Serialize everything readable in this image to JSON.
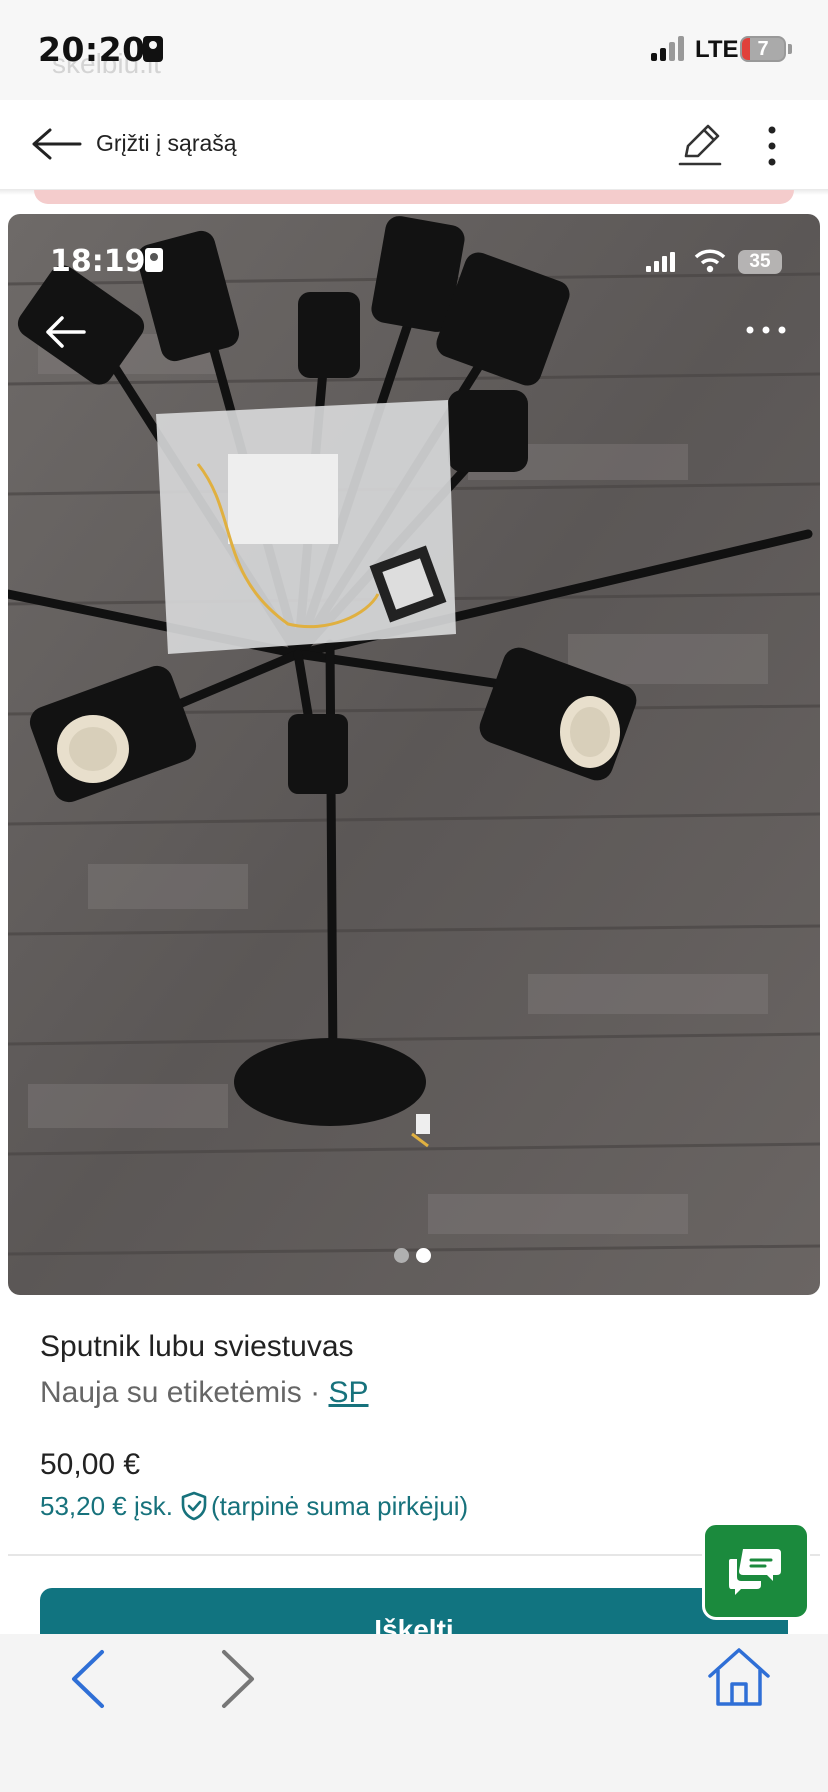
{
  "status_bar": {
    "time": "20:20",
    "network": "LTE",
    "battery_level": "7",
    "battery_color": "#e0403a",
    "background_logo_text": "skelbiu.lt"
  },
  "header": {
    "back_label": "Grįžti į sąrašą",
    "back_icon": "arrow-left-icon",
    "edit_icon": "pencil-icon",
    "more_icon": "more-vertical-icon"
  },
  "photo": {
    "embedded_status_time": "18:19",
    "embedded_battery_level": "35",
    "description_icon_back": "arrow-left-icon",
    "description_icon_more": "more-horizontal-icon",
    "pagination": {
      "count": 2,
      "active_index": 1
    }
  },
  "listing": {
    "title": "Sputnik lubu sviestuvas",
    "condition": "Nauja su etiketėmis",
    "separator": "·",
    "seller_tag": "SP",
    "price": "50,00 €",
    "buyer_price_prefix": "53,20 € įsk.",
    "buyer_price_suffix": "(tarpinė suma pirkėjui)",
    "cta_label": "Iškelti"
  },
  "colors": {
    "accent_teal": "#117480",
    "link_teal": "#17727c",
    "chat_green": "#1b8a3d",
    "nav_blue": "#2f6fd6"
  },
  "bottom_bar": {
    "back_icon": "chevron-left-icon",
    "forward_icon": "chevron-right-icon",
    "home_icon": "home-icon"
  }
}
